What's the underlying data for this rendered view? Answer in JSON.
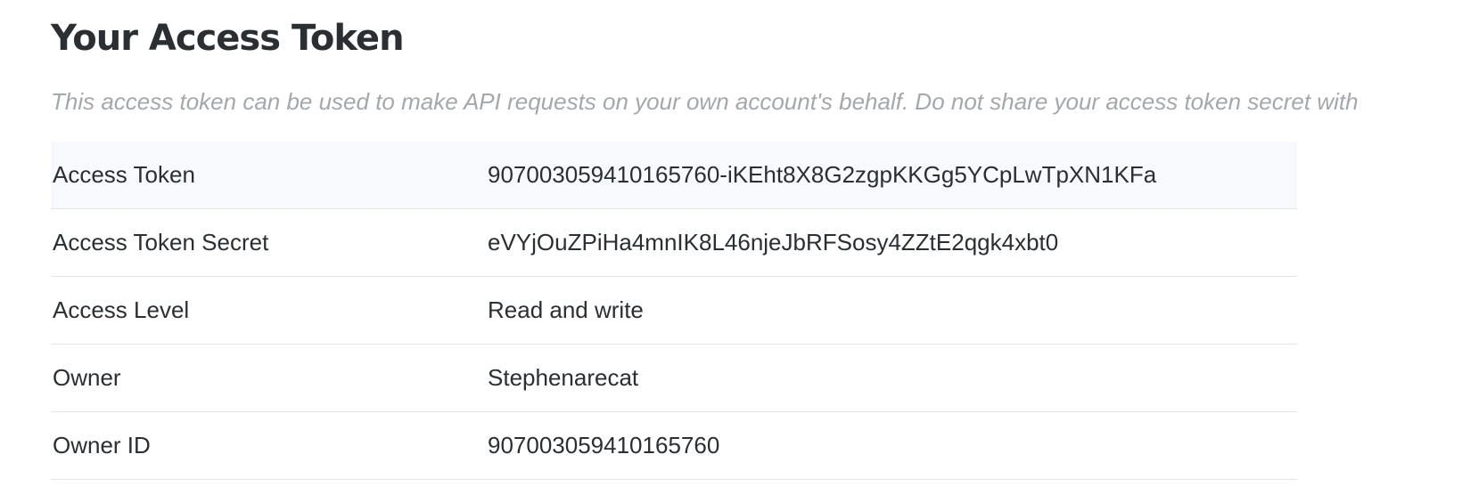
{
  "section": {
    "title": "Your Access Token",
    "description": "This access token can be used to make API requests on your own account's behalf. Do not share your access token secret with"
  },
  "token_table": {
    "rows": [
      {
        "label": "Access Token",
        "value": "907003059410165760-iKEht8X8G2zgpKKGg5YCpLwTpXN1KFa"
      },
      {
        "label": "Access Token Secret",
        "value": "eVYjOuZPiHa4mnIK8L46njeJbRFSosy4ZZtE2qgk4xbt0"
      },
      {
        "label": "Access Level",
        "value": "Read and write"
      },
      {
        "label": "Owner",
        "value": "Stephenarecat"
      },
      {
        "label": "Owner ID",
        "value": "907003059410165760"
      }
    ]
  }
}
